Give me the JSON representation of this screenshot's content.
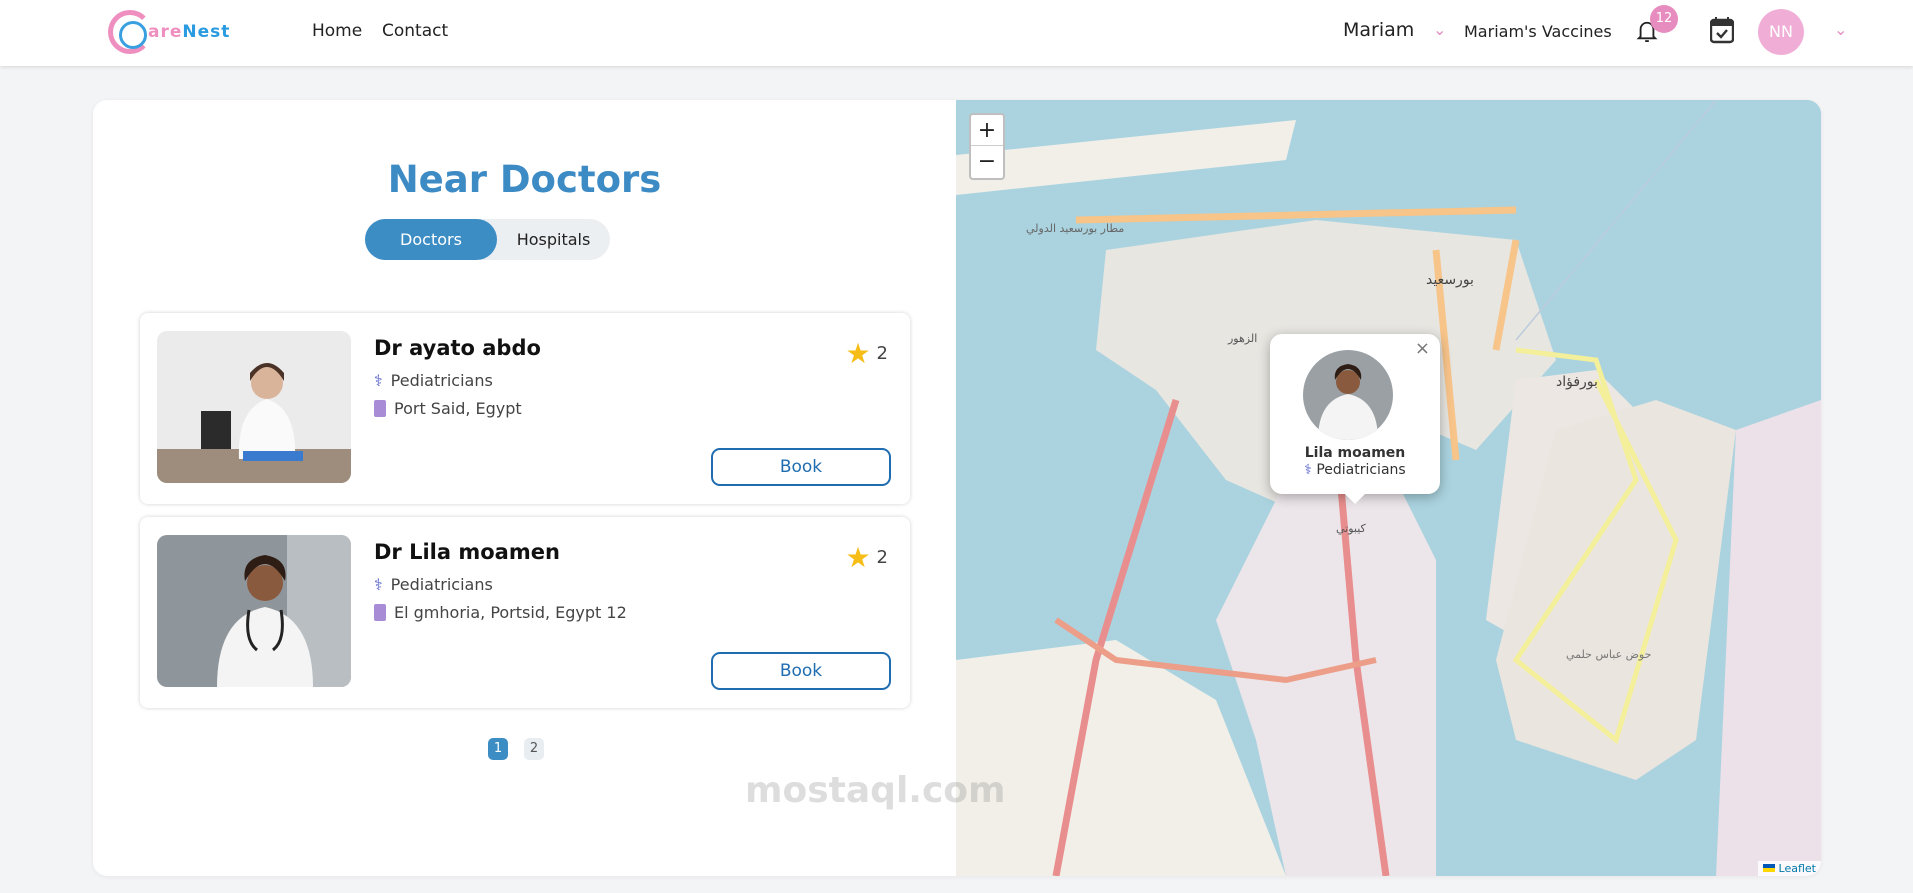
{
  "header": {
    "logo": "CareNest",
    "logo_parts": [
      "are",
      "Nest"
    ],
    "nav": [
      "Home",
      "Contact"
    ],
    "user": "Mariam",
    "vaccines": "Mariam's Vaccines",
    "notifications": "12",
    "avatar": "NN"
  },
  "main": {
    "title": "Near Doctors",
    "tabs": [
      "Doctors",
      "Hospitals"
    ],
    "doctors": [
      {
        "name": "Dr ayato abdo",
        "specialty": "Pediatricians",
        "location": "Port Said, Egypt",
        "rating": "2",
        "book": "Book"
      },
      {
        "name": "Dr Lila moamen",
        "specialty": "Pediatricians",
        "location": "El gmhoria, Portsid, Egypt 12",
        "rating": "2",
        "book": "Book"
      }
    ],
    "pages": [
      "1",
      "2"
    ]
  },
  "map": {
    "zoom_in": "+",
    "zoom_out": "−",
    "popup": {
      "name": "Lila moamen",
      "specialty": "Pediatricians",
      "close": "×"
    },
    "attribution": "Leaflet",
    "labels": [
      "بورسعيد",
      "بورفؤاد",
      "حوض عباس حلمي",
      "مطار بورسعيد الدولي",
      "كيبوتي",
      "الزهور"
    ]
  },
  "watermark": "mostaql.com"
}
